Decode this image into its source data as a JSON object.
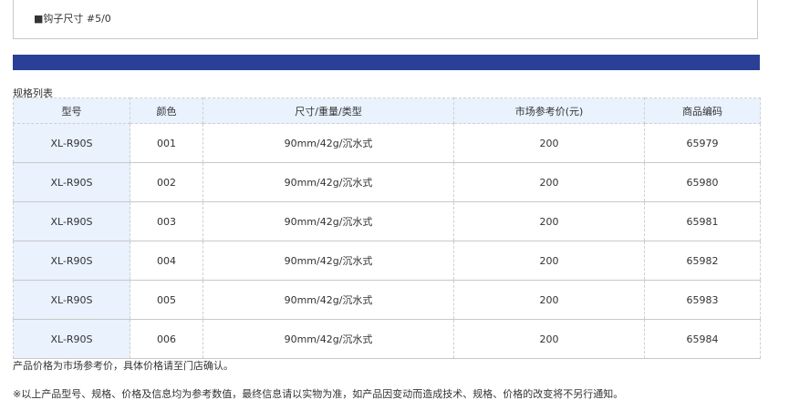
{
  "top_box": {
    "hook_size": "■钩子尺寸 #5/0"
  },
  "spec_title": "规格列表",
  "table": {
    "headers": [
      "型号",
      "颜色",
      "尺寸/重量/类型",
      "市场参考价(元)",
      "商品编码"
    ],
    "rows": [
      [
        "XL-R90S",
        "001",
        "90mm/42g/沉水式",
        "200",
        "65979"
      ],
      [
        "XL-R90S",
        "002",
        "90mm/42g/沉水式",
        "200",
        "65980"
      ],
      [
        "XL-R90S",
        "003",
        "90mm/42g/沉水式",
        "200",
        "65981"
      ],
      [
        "XL-R90S",
        "004",
        "90mm/42g/沉水式",
        "200",
        "65982"
      ],
      [
        "XL-R90S",
        "005",
        "90mm/42g/沉水式",
        "200",
        "65983"
      ],
      [
        "XL-R90S",
        "006",
        "90mm/42g/沉水式",
        "200",
        "65984"
      ]
    ]
  },
  "footnotes": {
    "price_note": "产品价格为市场参考价，具体价格请至门店确认。",
    "disclaimer": "※以上产品型号、规格、价格及信息均为参考数值，最终信息请以实物为准，如产品因变动而造成技术、规格、价格的改变将不另行通知。"
  },
  "colors": {
    "banner": "#2a3f96",
    "header_bg": "#e9f2fd"
  }
}
